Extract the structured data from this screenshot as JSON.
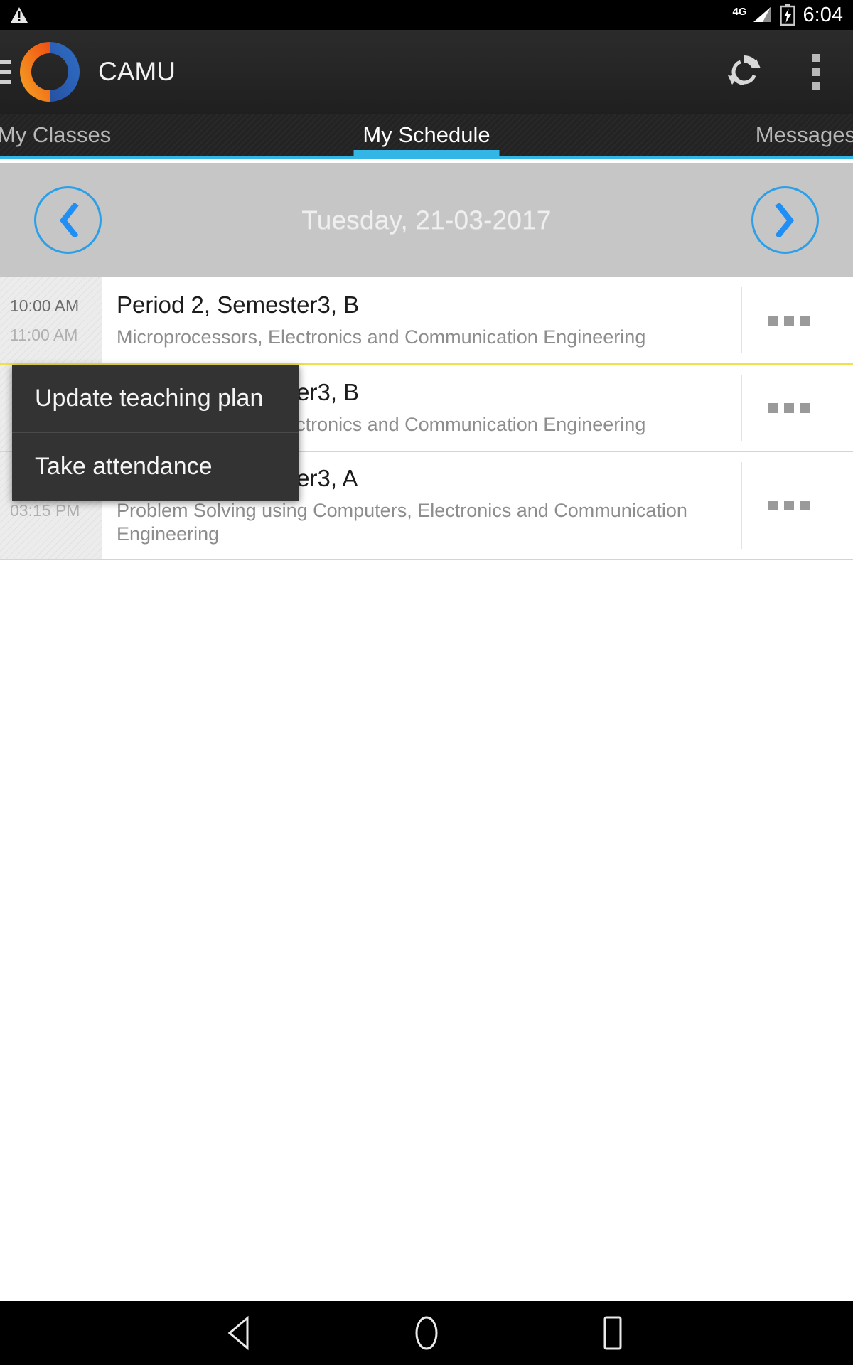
{
  "status_bar": {
    "warning_icon": "warning-triangle-icon",
    "network_type": "4G",
    "signal_icon": "signal-bars-icon",
    "battery_icon": "battery-charging-icon",
    "time": "6:04"
  },
  "action_bar": {
    "menu_icon": "hamburger-menu-icon",
    "logo_icon": "camu-ring-logo",
    "title": "CAMU",
    "sync_icon": "sync-refresh-icon",
    "overflow_icon": "overflow-menu-icon"
  },
  "tabs": [
    {
      "label": "My Classes",
      "active": false
    },
    {
      "label": "My Schedule",
      "active": true
    },
    {
      "label": "Messages",
      "active": false
    }
  ],
  "date_nav": {
    "prev_icon": "chevron-left-icon",
    "next_icon": "chevron-right-icon",
    "date": "Tuesday, 21-03-2017"
  },
  "schedule": [
    {
      "start_time": "10:00 AM",
      "end_time": "11:00 AM",
      "title": "Period 2, Semester3, B",
      "subtitle": "Microprocessors, Electronics and Communication Engineering",
      "menu_icon": "row-overflow-icon"
    },
    {
      "start_time": "",
      "end_time": "",
      "title": "Period 3, Semester3, B",
      "subtitle": "Microprocessors, Electronics and Communication Engineering",
      "menu_icon": "row-overflow-icon"
    },
    {
      "start_time": "",
      "end_time": "03:15 PM",
      "title": "Period 7, Semester3, A",
      "subtitle": "Problem Solving using Computers, Electronics and Communication Engineering",
      "menu_icon": "row-overflow-icon"
    }
  ],
  "context_menu": {
    "items": [
      {
        "label": "Update teaching plan"
      },
      {
        "label": "Take attendance"
      }
    ]
  },
  "nav_bar": {
    "back_icon": "back-triangle-icon",
    "home_icon": "home-circle-icon",
    "recents_icon": "recents-square-icon"
  },
  "colors": {
    "accent_blue": "#33b5e5",
    "divider_yellow": "#f1e04a",
    "action_bar_bg": "#252525",
    "date_bar_bg": "#c6c6c6",
    "menu_bg": "#333333"
  }
}
